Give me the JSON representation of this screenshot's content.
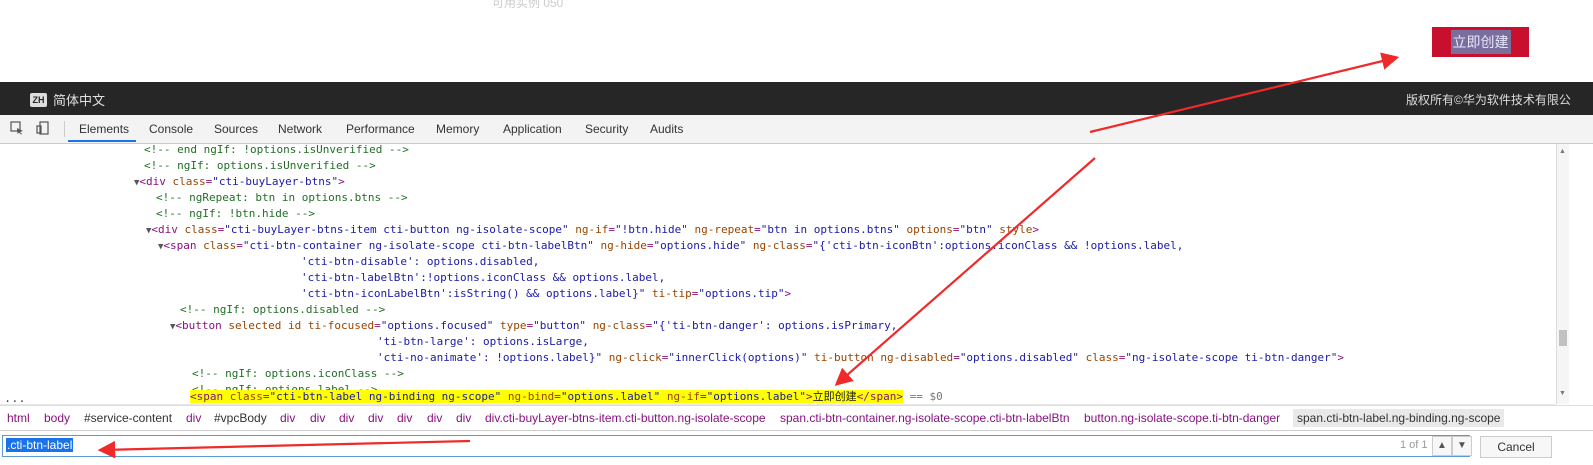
{
  "page": {
    "faint_text": "可用实例 050",
    "create_button": "立即创建"
  },
  "footer": {
    "lang_badge": "ZH",
    "lang_label": "简体中文",
    "copyright": "版权所有©华为软件技术有限公"
  },
  "devtools": {
    "tabs": [
      "Elements",
      "Console",
      "Sources",
      "Network",
      "Performance",
      "Memory",
      "Application",
      "Security",
      "Audits"
    ],
    "active_tab": "Elements",
    "selected_suffix": "== $0",
    "breadcrumbs": [
      "html",
      "body",
      "#service-content",
      "div",
      "#vpcBody",
      "div",
      "div",
      "div",
      "div",
      "div",
      "div",
      "div",
      "div.cti-buyLayer-btns-item.cti-button.ng-isolate-scope",
      "span.cti-btn-container.ng-isolate-scope.cti-btn-labelBtn",
      "button.ng-isolate-scope.ti-btn-danger",
      "span.cti-btn-label.ng-binding.ng-scope"
    ],
    "search_query": ".cti-btn-label",
    "search_count": "1 of 1",
    "cancel_label": "Cancel",
    "ellipsis": "..."
  },
  "code_lines": {
    "l1": "<!-- end ngIf: !options.isUnverified -->",
    "l2": "<!-- ngIf: options.isUnverified -->",
    "l4": "<!-- ngRepeat: btn in options.btns -->",
    "l5": "<!-- ngIf: !btn.hide -->",
    "l10": "<!-- ngIf: options.disabled -->",
    "l14": "<!-- ngIf: options.iconClass -->",
    "l15": "<!-- ngIf: options.label -->",
    "l16_text": "立即创建"
  }
}
